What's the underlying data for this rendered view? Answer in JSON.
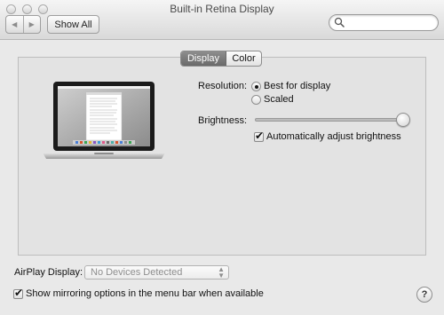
{
  "window": {
    "title": "Built-in Retina Display"
  },
  "toolbar": {
    "back_glyph": "◀",
    "forward_glyph": "▶",
    "show_all_label": "Show All",
    "search_value": "",
    "search_placeholder": ""
  },
  "tabs": [
    {
      "label": "Display",
      "selected": true
    },
    {
      "label": "Color",
      "selected": false
    }
  ],
  "display": {
    "resolution_label": "Resolution:",
    "options": [
      {
        "label": "Best for display",
        "selected": true
      },
      {
        "label": "Scaled",
        "selected": false
      }
    ],
    "brightness_label": "Brightness:",
    "brightness_value": 0.98,
    "auto_brightness_label": "Automatically adjust brightness",
    "auto_brightness_checked": true,
    "check_glyph": "✔"
  },
  "airplay": {
    "label": "AirPlay Display:",
    "value": "No Devices Detected",
    "arrows": "▲▼"
  },
  "mirroring": {
    "label": "Show mirroring options in the menu bar when available",
    "checked": true,
    "check_glyph": "✔"
  },
  "help_label": "?"
}
